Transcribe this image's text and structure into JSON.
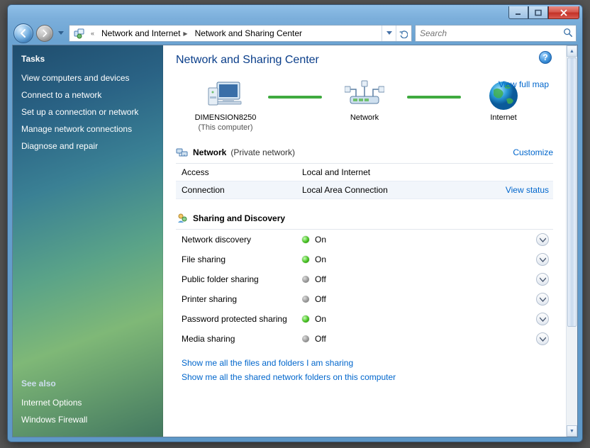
{
  "breadcrumb": {
    "seg1": "Network and Internet",
    "seg2": "Network and Sharing Center"
  },
  "search": {
    "placeholder": "Search"
  },
  "sidebar": {
    "title": "Tasks",
    "links": {
      "0": "View computers and devices",
      "1": "Connect to a network",
      "2": "Set up a connection or network",
      "3": "Manage network connections",
      "4": "Diagnose and repair"
    },
    "seeAlsoTitle": "See also",
    "seeAlso": {
      "0": "Internet Options",
      "1": "Windows Firewall"
    }
  },
  "page": {
    "title": "Network and Sharing Center",
    "viewFullMap": "View full map",
    "map": {
      "pcName": "DIMENSION8250",
      "pcSub": "(This computer)",
      "netName": "Network",
      "inetName": "Internet"
    }
  },
  "netSection": {
    "title": "Network",
    "paren": "(Private network)",
    "customize": "Customize",
    "accessLabel": "Access",
    "accessValue": "Local and Internet",
    "connLabel": "Connection",
    "connValue": "Local Area Connection",
    "viewStatus": "View status"
  },
  "discSection": {
    "title": "Sharing and Discovery",
    "rows": {
      "0": {
        "label": "Network discovery",
        "state": "On",
        "on": true
      },
      "1": {
        "label": "File sharing",
        "state": "On",
        "on": true
      },
      "2": {
        "label": "Public folder sharing",
        "state": "Off",
        "on": false
      },
      "3": {
        "label": "Printer sharing",
        "state": "Off",
        "on": false
      },
      "4": {
        "label": "Password protected sharing",
        "state": "On",
        "on": true
      },
      "5": {
        "label": "Media sharing",
        "state": "Off",
        "on": false
      }
    }
  },
  "bottomLinks": {
    "0": "Show me all the files and folders I am sharing",
    "1": "Show me all the shared network folders on this computer"
  }
}
